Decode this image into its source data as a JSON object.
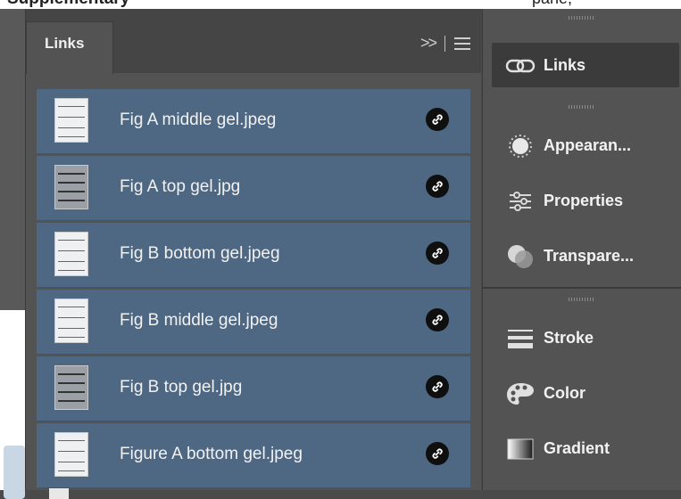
{
  "document": {
    "top_text_left": "Supplementary",
    "top_text_right": "pane,"
  },
  "links_panel": {
    "tab_label": "Links",
    "expand_icon": "chevron-double-right-icon",
    "menu_icon": "hamburger-menu-icon",
    "items": [
      {
        "name": "Fig A middle gel.jpeg",
        "thumb_style": "light",
        "status_icon": "link-icon"
      },
      {
        "name": "Fig A top gel.jpg",
        "thumb_style": "dark",
        "status_icon": "link-icon"
      },
      {
        "name": "Fig B bottom gel.jpeg",
        "thumb_style": "light",
        "status_icon": "link-icon"
      },
      {
        "name": "Fig B middle gel.jpeg",
        "thumb_style": "light",
        "status_icon": "link-icon"
      },
      {
        "name": "Fig B top gel.jpg",
        "thumb_style": "dark",
        "status_icon": "link-icon"
      },
      {
        "name": "Figure A bottom gel.jpeg",
        "thumb_style": "light",
        "status_icon": "link-icon"
      }
    ],
    "selection_color": "#4e6782"
  },
  "dock": {
    "items": [
      {
        "label": "Links",
        "icon": "chain-link-icon",
        "active": true
      },
      {
        "label": "Appearan...",
        "icon": "appearance-icon",
        "active": false
      },
      {
        "label": "Properties",
        "icon": "sliders-icon",
        "active": false
      },
      {
        "label": "Transpare...",
        "icon": "transparency-icon",
        "active": false
      },
      {
        "label": "Stroke",
        "icon": "stroke-icon",
        "active": false
      },
      {
        "label": "Color",
        "icon": "palette-icon",
        "active": false
      },
      {
        "label": "Gradient",
        "icon": "gradient-icon",
        "active": false
      }
    ]
  }
}
